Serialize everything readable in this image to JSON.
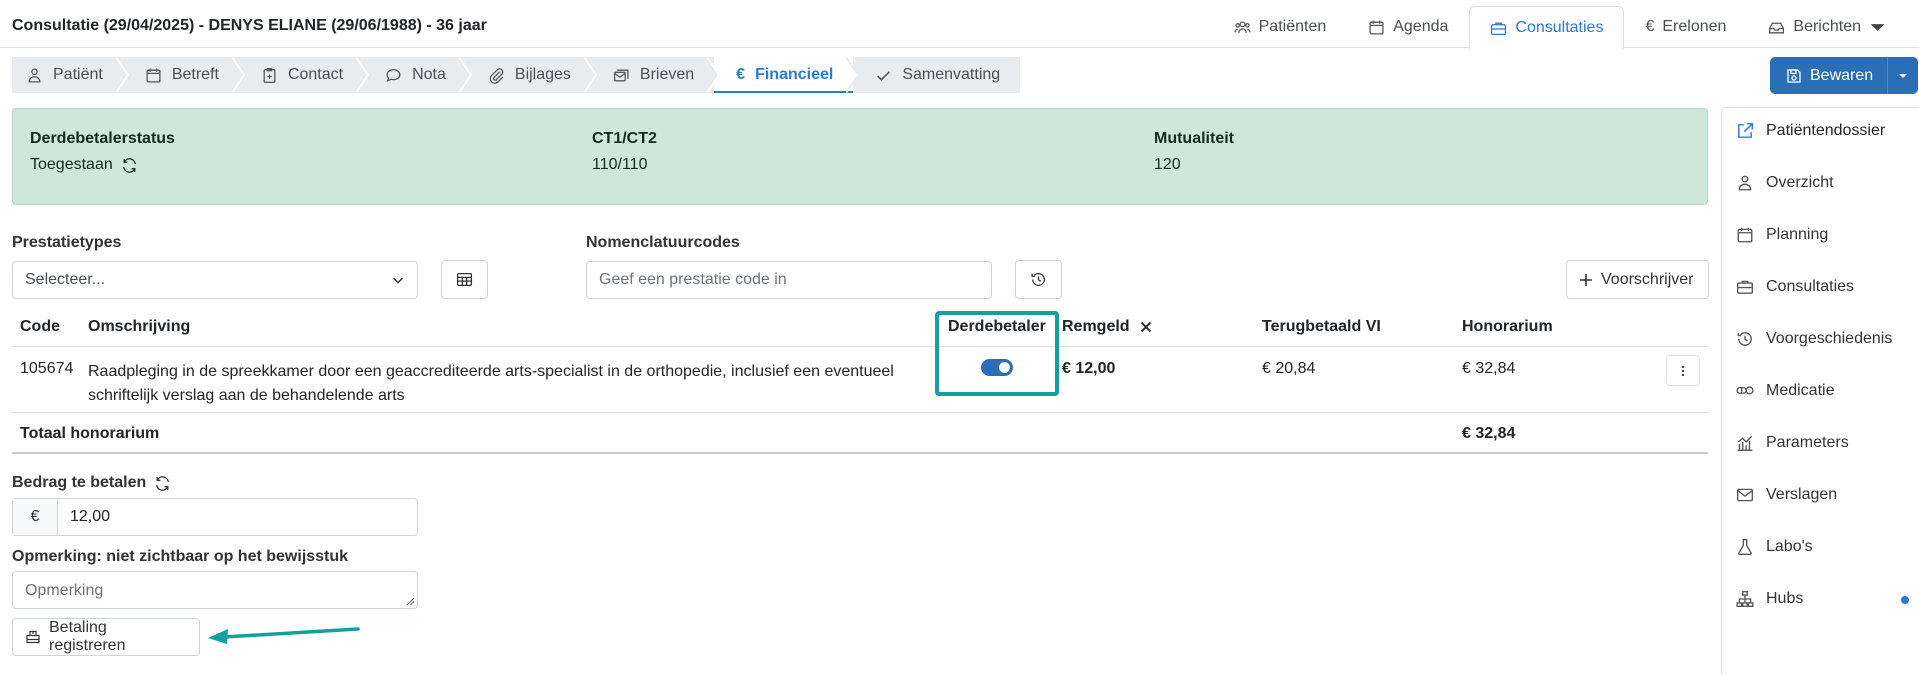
{
  "header": {
    "title": "Consultatie (29/04/2025) - DENYS ELIANE (29/06/1988) - 36 jaar",
    "nav": [
      {
        "label": "Patiënten",
        "icon": "users-icon"
      },
      {
        "label": "Agenda",
        "icon": "calendar-icon"
      },
      {
        "label": "Consultaties",
        "icon": "briefcase-icon",
        "active": true
      },
      {
        "label": "Erelonen",
        "icon": "euro-icon"
      },
      {
        "label": "Berichten",
        "icon": "inbox-icon"
      }
    ]
  },
  "tabs": [
    {
      "label": "Patiënt",
      "icon": "person-icon"
    },
    {
      "label": "Betreft",
      "icon": "calendar-icon"
    },
    {
      "label": "Contact",
      "icon": "clipboard-plus-icon"
    },
    {
      "label": "Nota",
      "icon": "chat-icon"
    },
    {
      "label": "Bijlages",
      "icon": "paperclip-icon"
    },
    {
      "label": "Brieven",
      "icon": "mail-stack-icon"
    },
    {
      "label": "Financieel",
      "icon": "euro-icon",
      "active": true
    },
    {
      "label": "Samenvatting",
      "icon": "check-icon"
    }
  ],
  "save_button": {
    "label": "Bewaren"
  },
  "info": {
    "derdebetaler_label": "Derdebetalerstatus",
    "derdebetaler_value": "Toegestaan",
    "ct_label": "CT1/CT2",
    "ct_value": "110/110",
    "mutualiteit_label": "Mutualiteit",
    "mutualiteit_value": "120"
  },
  "form": {
    "prestatietypes_label": "Prestatietypes",
    "prestatietypes_value": "Selecteer...",
    "nomenclatuur_label": "Nomenclatuurcodes",
    "nomenclatuur_placeholder": "Geef een prestatie code in",
    "voorschrijver_label": "Voorschrijver"
  },
  "table": {
    "headers": {
      "code": "Code",
      "omschrijving": "Omschrijving",
      "derdebetaler": "Derdebetaler",
      "remgeld": "Remgeld",
      "terugbetaald": "Terugbetaald VI",
      "honorarium": "Honorarium"
    },
    "rows": [
      {
        "code": "105674",
        "omschrijving_line1": "Raadpleging in de spreekkamer door een geaccrediteerde arts-specialist in de orthopedie, inclusief een eventueel",
        "omschrijving_line2": "schriftelijk verslag aan de behandelende arts",
        "derdebetaler_on": true,
        "remgeld": "€ 12,00",
        "terugbetaald": "€ 20,84",
        "honorarium": "€ 32,84"
      }
    ],
    "total_label": "Totaal honorarium",
    "total_value": "€ 32,84"
  },
  "payment": {
    "amount_label": "Bedrag te betalen",
    "currency_symbol": "€",
    "amount_value": "12,00",
    "remark_label": "Opmerking: niet zichtbaar op het bewijsstuk",
    "remark_placeholder": "Opmerking",
    "register_button": "Betaling registreren"
  },
  "sidebar": [
    {
      "label": "Patiëntendossier",
      "icon": "external-link-icon"
    },
    {
      "label": "Overzicht",
      "icon": "person-icon"
    },
    {
      "label": "Planning",
      "icon": "calendar-icon"
    },
    {
      "label": "Consultaties",
      "icon": "briefcase-icon"
    },
    {
      "label": "Voorgeschiedenis",
      "icon": "history-icon"
    },
    {
      "label": "Medicatie",
      "icon": "pills-icon"
    },
    {
      "label": "Parameters",
      "icon": "chart-icon"
    },
    {
      "label": "Verslagen",
      "icon": "envelope-icon"
    },
    {
      "label": "Labo's",
      "icon": "flask-icon"
    },
    {
      "label": "Hubs",
      "icon": "network-icon"
    }
  ],
  "colors": {
    "accent": "#2a7bd2",
    "primary_button": "#2a6fb5",
    "info_background": "#cfe7db",
    "highlight": "#14a0a0"
  }
}
